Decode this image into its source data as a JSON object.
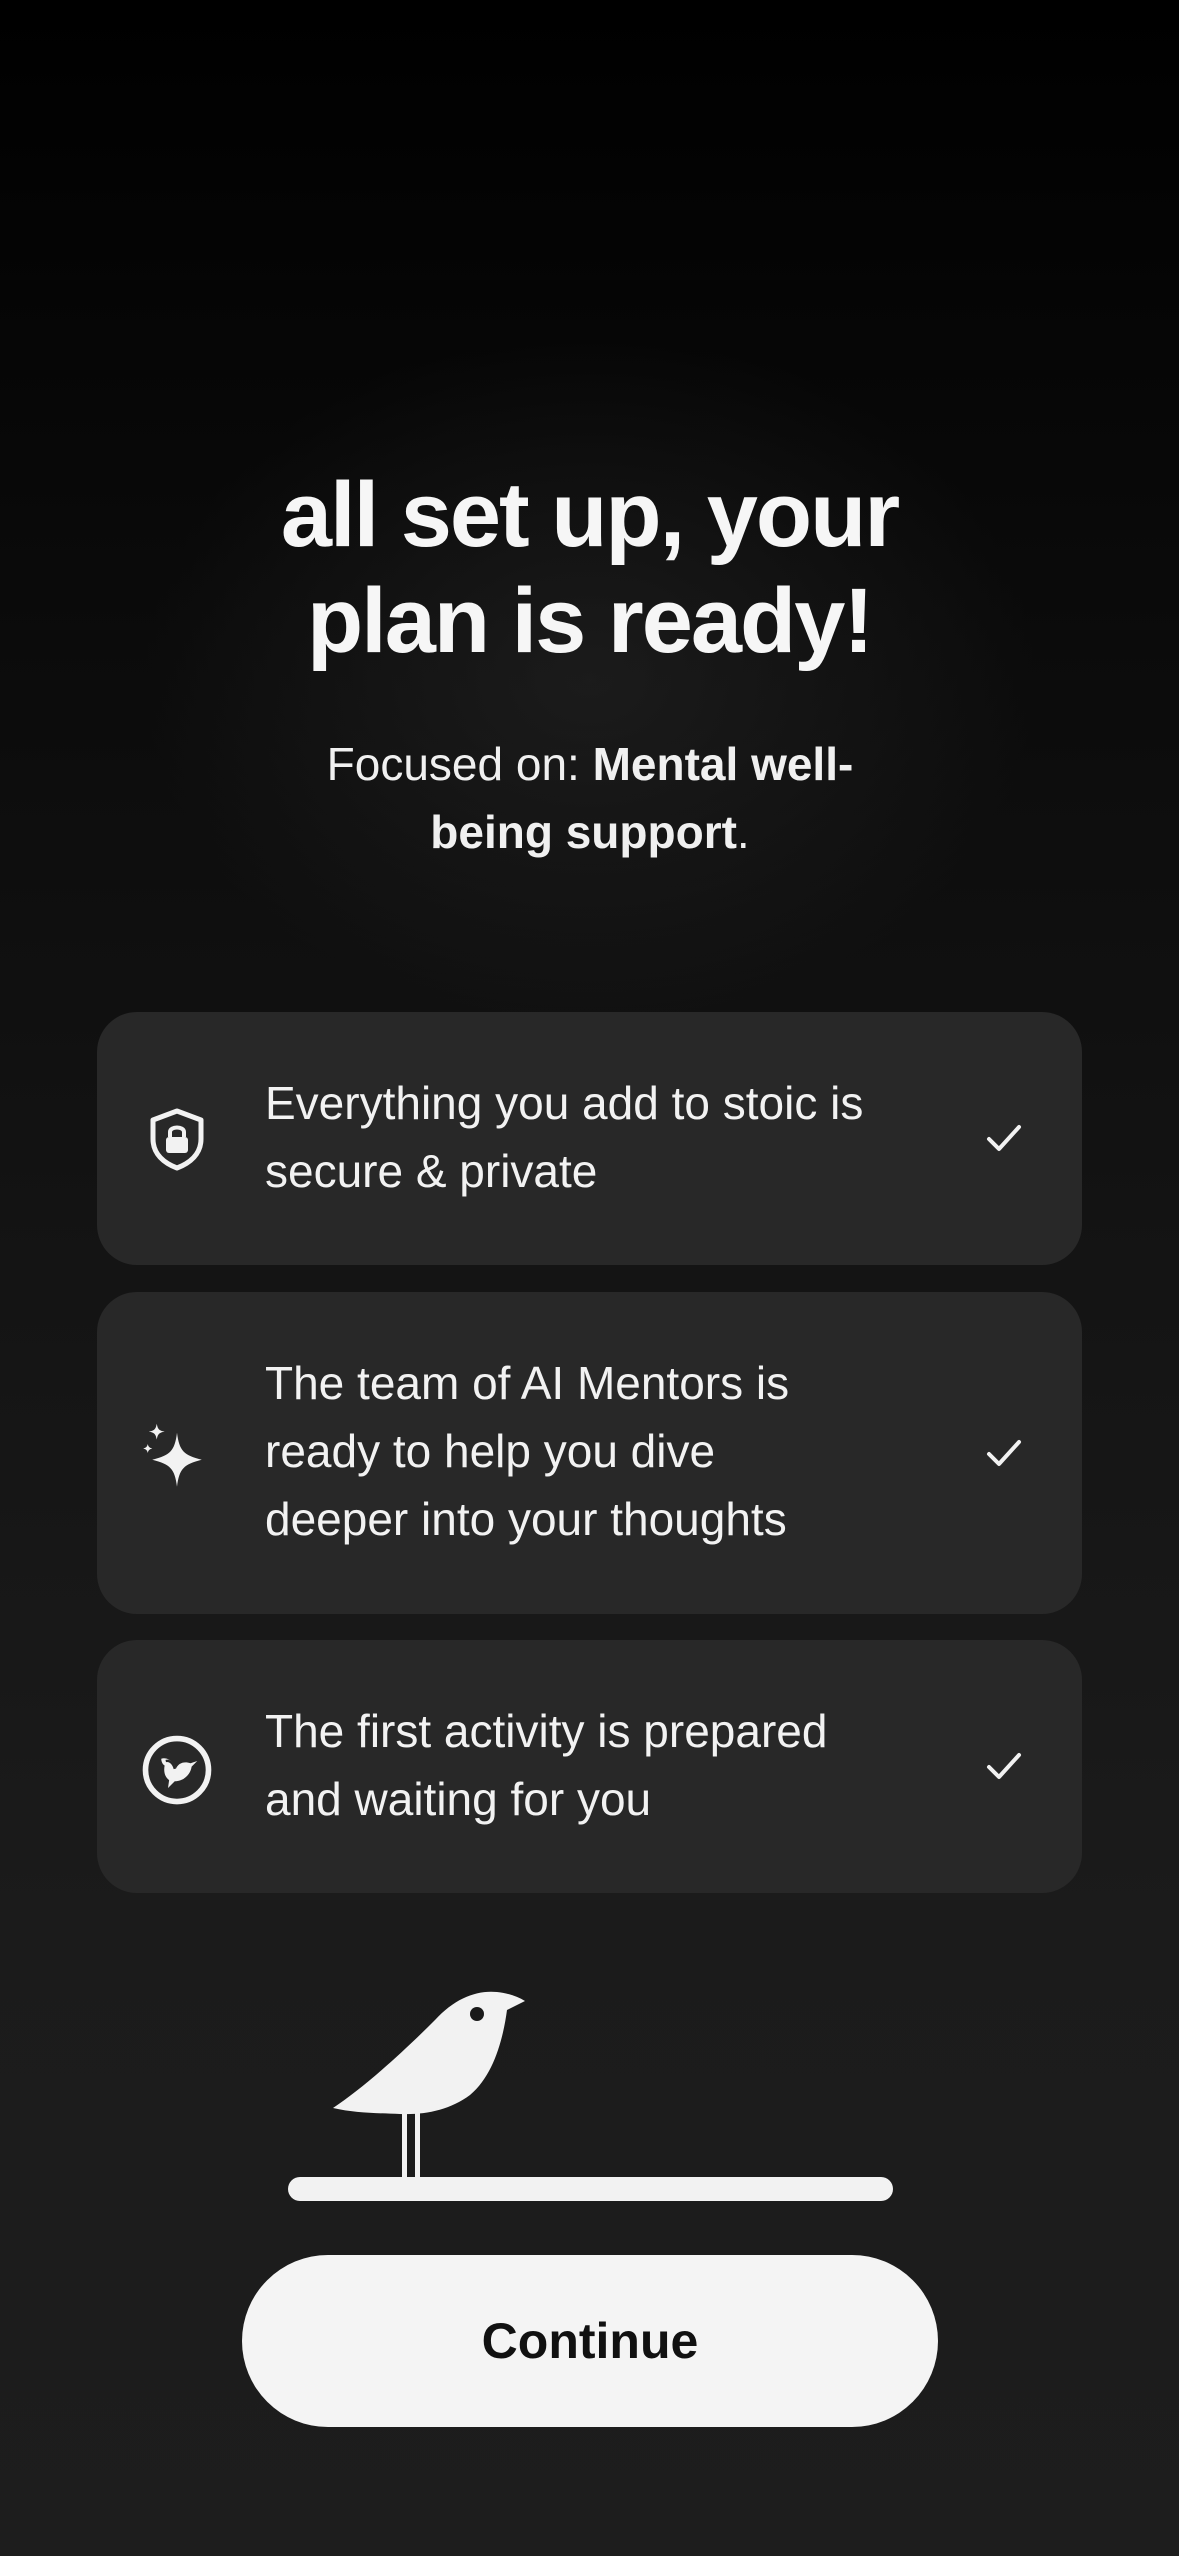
{
  "header": {
    "title_line1": "all set up, your",
    "title_line2": "plan is ready!",
    "focus_prefix": "Focused on: ",
    "focus_value_part1": "Mental well-",
    "focus_value_part2": "being support",
    "focus_suffix": "."
  },
  "features": [
    {
      "icon": "shield-lock-icon",
      "line1": "Everything you add to stoic is",
      "line2": "secure & private",
      "checked": true
    },
    {
      "icon": "sparkles-icon",
      "line1": "The team of AI Mentors is",
      "line2": "ready to help you dive",
      "line3": "deeper into your thoughts",
      "checked": true
    },
    {
      "icon": "hummingbird-icon",
      "line1": "The first activity is prepared",
      "line2": "and waiting for you",
      "checked": true
    }
  ],
  "illustration": {
    "name": "bird-on-progress-bar",
    "progress": 1.0
  },
  "footer": {
    "continue_label": "Continue"
  },
  "colors": {
    "background_top": "#000000",
    "background_bottom": "#1d1d1d",
    "card": "#282828",
    "text": "#f4f4f4",
    "button": "#f4f4f4",
    "button_text": "#111111"
  }
}
